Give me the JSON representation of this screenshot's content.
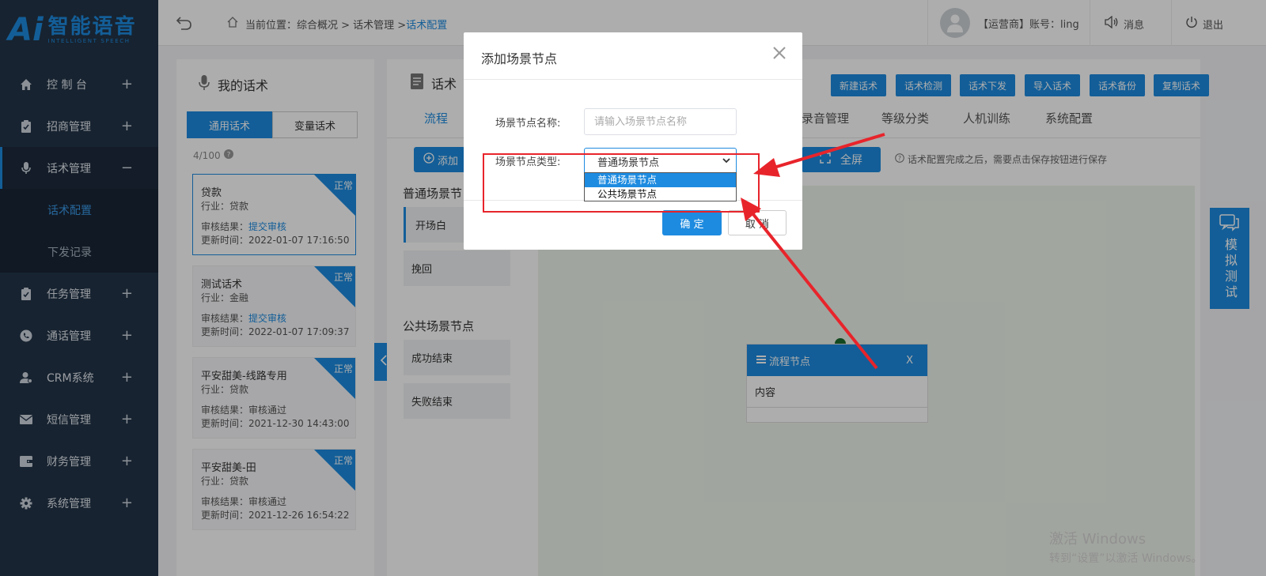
{
  "logo": {
    "mark": "Ai",
    "title": "智能语音",
    "subtitle": "INTELLIGENT SPEECH"
  },
  "sidebar": {
    "items": [
      {
        "label": "控 制 台",
        "icon": "home-icon",
        "toggle": "+"
      },
      {
        "label": "招商管理",
        "icon": "clipboard-icon",
        "toggle": "+"
      },
      {
        "label": "话术管理",
        "icon": "microphone-icon",
        "toggle": "−"
      },
      {
        "label": "任务管理",
        "icon": "clipboard-icon",
        "toggle": "+"
      },
      {
        "label": "通话管理",
        "icon": "phone-icon",
        "toggle": "+"
      },
      {
        "label": "CRM系统",
        "icon": "user-icon",
        "toggle": "+"
      },
      {
        "label": "短信管理",
        "icon": "mail-icon",
        "toggle": "+"
      },
      {
        "label": "财务管理",
        "icon": "wallet-icon",
        "toggle": "+"
      },
      {
        "label": "系统管理",
        "icon": "gear-icon",
        "toggle": "+"
      }
    ],
    "subitems": [
      {
        "label": "话术配置"
      },
      {
        "label": "下发记录"
      }
    ]
  },
  "topbar": {
    "breadcrumb_prefix": "当前位置：综合概况 > 话术管理 > ",
    "breadcrumb_current": "话术配置",
    "user": "【运营商】账号：ling",
    "messages": "消息",
    "logout": "退出"
  },
  "left_panel": {
    "title": "我的话术",
    "tab_general": "通用话术",
    "tab_variable": "变量话术",
    "count": "4/100",
    "cards": [
      {
        "name": "贷款",
        "industry": "行业：贷款",
        "audit_label": "审核结果：",
        "audit_value": "提交审核",
        "audit_link": true,
        "updated": "更新时间：2022-01-07 17:16:50",
        "status": "正常"
      },
      {
        "name": "测试话术",
        "industry": "行业：金融",
        "audit_label": "审核结果：",
        "audit_value": "提交审核",
        "audit_link": true,
        "updated": "更新时间：2022-01-07 17:09:37",
        "status": "正常"
      },
      {
        "name": "平安甜美-线路专用",
        "industry": "行业：贷款",
        "audit_label": "审核结果：",
        "audit_value": "审核通过",
        "audit_link": false,
        "updated": "更新时间：2021-12-30 14:43:00",
        "status": "正常"
      },
      {
        "name": "平安甜美-田",
        "industry": "行业：贷款",
        "audit_label": "审核结果：",
        "audit_value": "审核通过",
        "audit_link": false,
        "updated": "更新时间：2021-12-26 16:54:22",
        "status": "正常"
      }
    ]
  },
  "main_panel": {
    "title": "话术",
    "header_buttons": [
      "新建话术",
      "话术检测",
      "话术下发",
      "导入话术",
      "话术备份",
      "复制话术"
    ],
    "tabs": [
      "流程",
      "录音管理",
      "等级分类",
      "人机训练",
      "系统配置"
    ],
    "add_button": "添加",
    "fullscreen_button": "全屏",
    "hint": "话术配置完成之后，需要点击保存按钮进行保存",
    "section_normal": "普通场景节",
    "normal_nodes": [
      "开场白",
      "挽回"
    ],
    "section_public": "公共场景节点",
    "public_nodes": [
      "成功结束",
      "失败结束"
    ],
    "flow_node": {
      "title": "流程节点",
      "close": "X",
      "content": "内容"
    }
  },
  "simulate": {
    "label": "模拟测试"
  },
  "modal": {
    "title": "添加场景节点",
    "name_label": "场景节点名称:",
    "name_placeholder": "请输入场景节点名称",
    "type_label": "场景节点类型:",
    "type_value": "普通场景节点",
    "type_options": [
      "普通场景节点",
      "公共场景节点"
    ],
    "ok": "确 定",
    "cancel": "取 消"
  },
  "watermark": {
    "line1": "激活 Windows",
    "line2": "转到“设置”以激活 Windows。"
  },
  "colors": {
    "accent": "#1d8be0",
    "sidebar": "#233448",
    "annotation": "#e8242b"
  }
}
